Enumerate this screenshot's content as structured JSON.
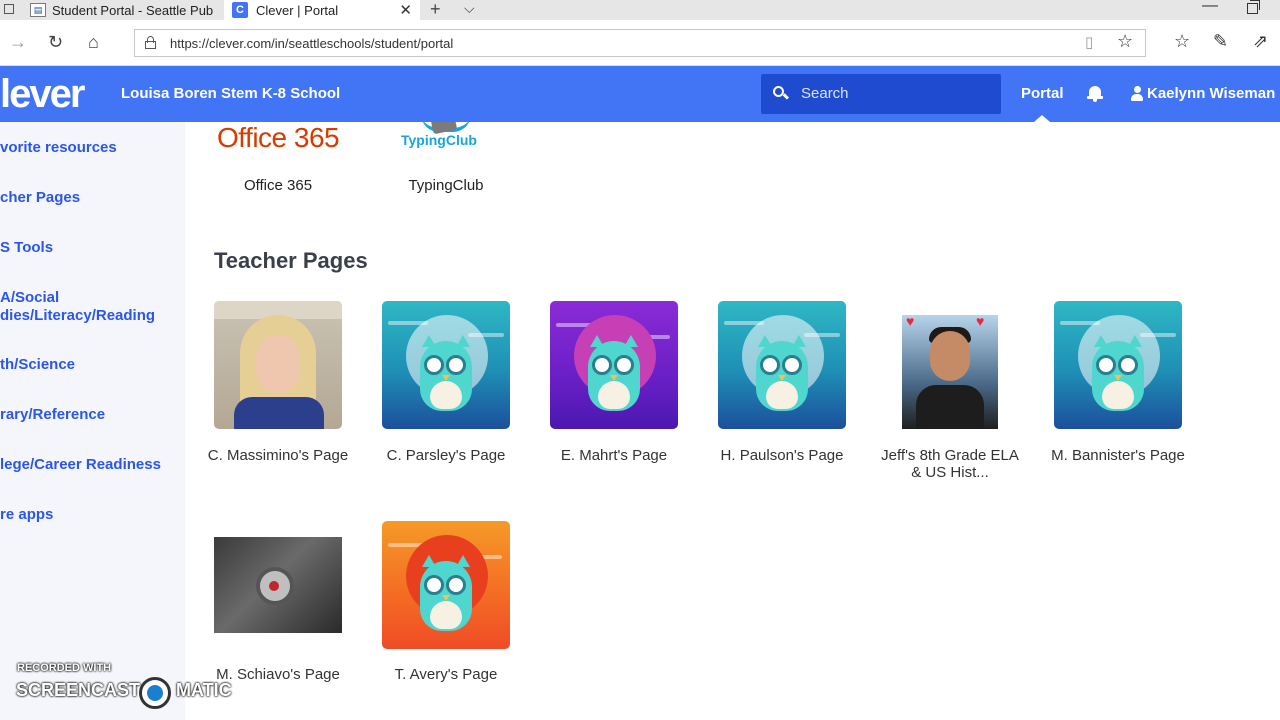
{
  "browser": {
    "tabs": [
      {
        "title": "Student Portal - Seattle Pub"
      },
      {
        "title": "Clever | Portal"
      }
    ],
    "url": "https://clever.com/in/seattleschools/student/portal"
  },
  "header": {
    "logo": "lever",
    "school": "Louisa Boren Stem K-8 School",
    "search_placeholder": "Search",
    "portal": "Portal",
    "user": "Kaelynn Wiseman",
    "brand_color": "#4274f6"
  },
  "sidebar": {
    "items": [
      {
        "label": "vorite resources"
      },
      {
        "label": "cher Pages"
      },
      {
        "label": "S Tools"
      },
      {
        "label": "A/Social",
        "label2": "dies/Literacy/Reading"
      },
      {
        "label": "th/Science"
      },
      {
        "label": "rary/Reference"
      },
      {
        "label": "lege/Career Readiness"
      },
      {
        "label": "re apps"
      }
    ]
  },
  "resources": {
    "items": [
      {
        "label": "Office 365",
        "logo_text": "Office 365"
      },
      {
        "label": "TypingClub",
        "logo_text": "TypingClub"
      }
    ]
  },
  "teacher_pages": {
    "title": "Teacher Pages",
    "items": [
      {
        "label": "C. Massimino's Page",
        "icon": "woman-photo"
      },
      {
        "label": "C. Parsley's Page",
        "icon": "owl-teal"
      },
      {
        "label": "E. Mahrt's Page",
        "icon": "owl-purple"
      },
      {
        "label": "H. Paulson's Page",
        "icon": "owl-teal"
      },
      {
        "label": "Jeff's 8th Grade ELA & US Hist...",
        "icon": "man-photo"
      },
      {
        "label": "M. Bannister's Page",
        "icon": "owl-teal"
      },
      {
        "label": "M. Schiavo's Page",
        "icon": "dark-photo"
      },
      {
        "label": "T. Avery's Page",
        "icon": "owl-orange"
      }
    ]
  },
  "watermark": {
    "top": "RECORDED WITH",
    "left": "SCREENCAST",
    "right": "MATIC"
  }
}
